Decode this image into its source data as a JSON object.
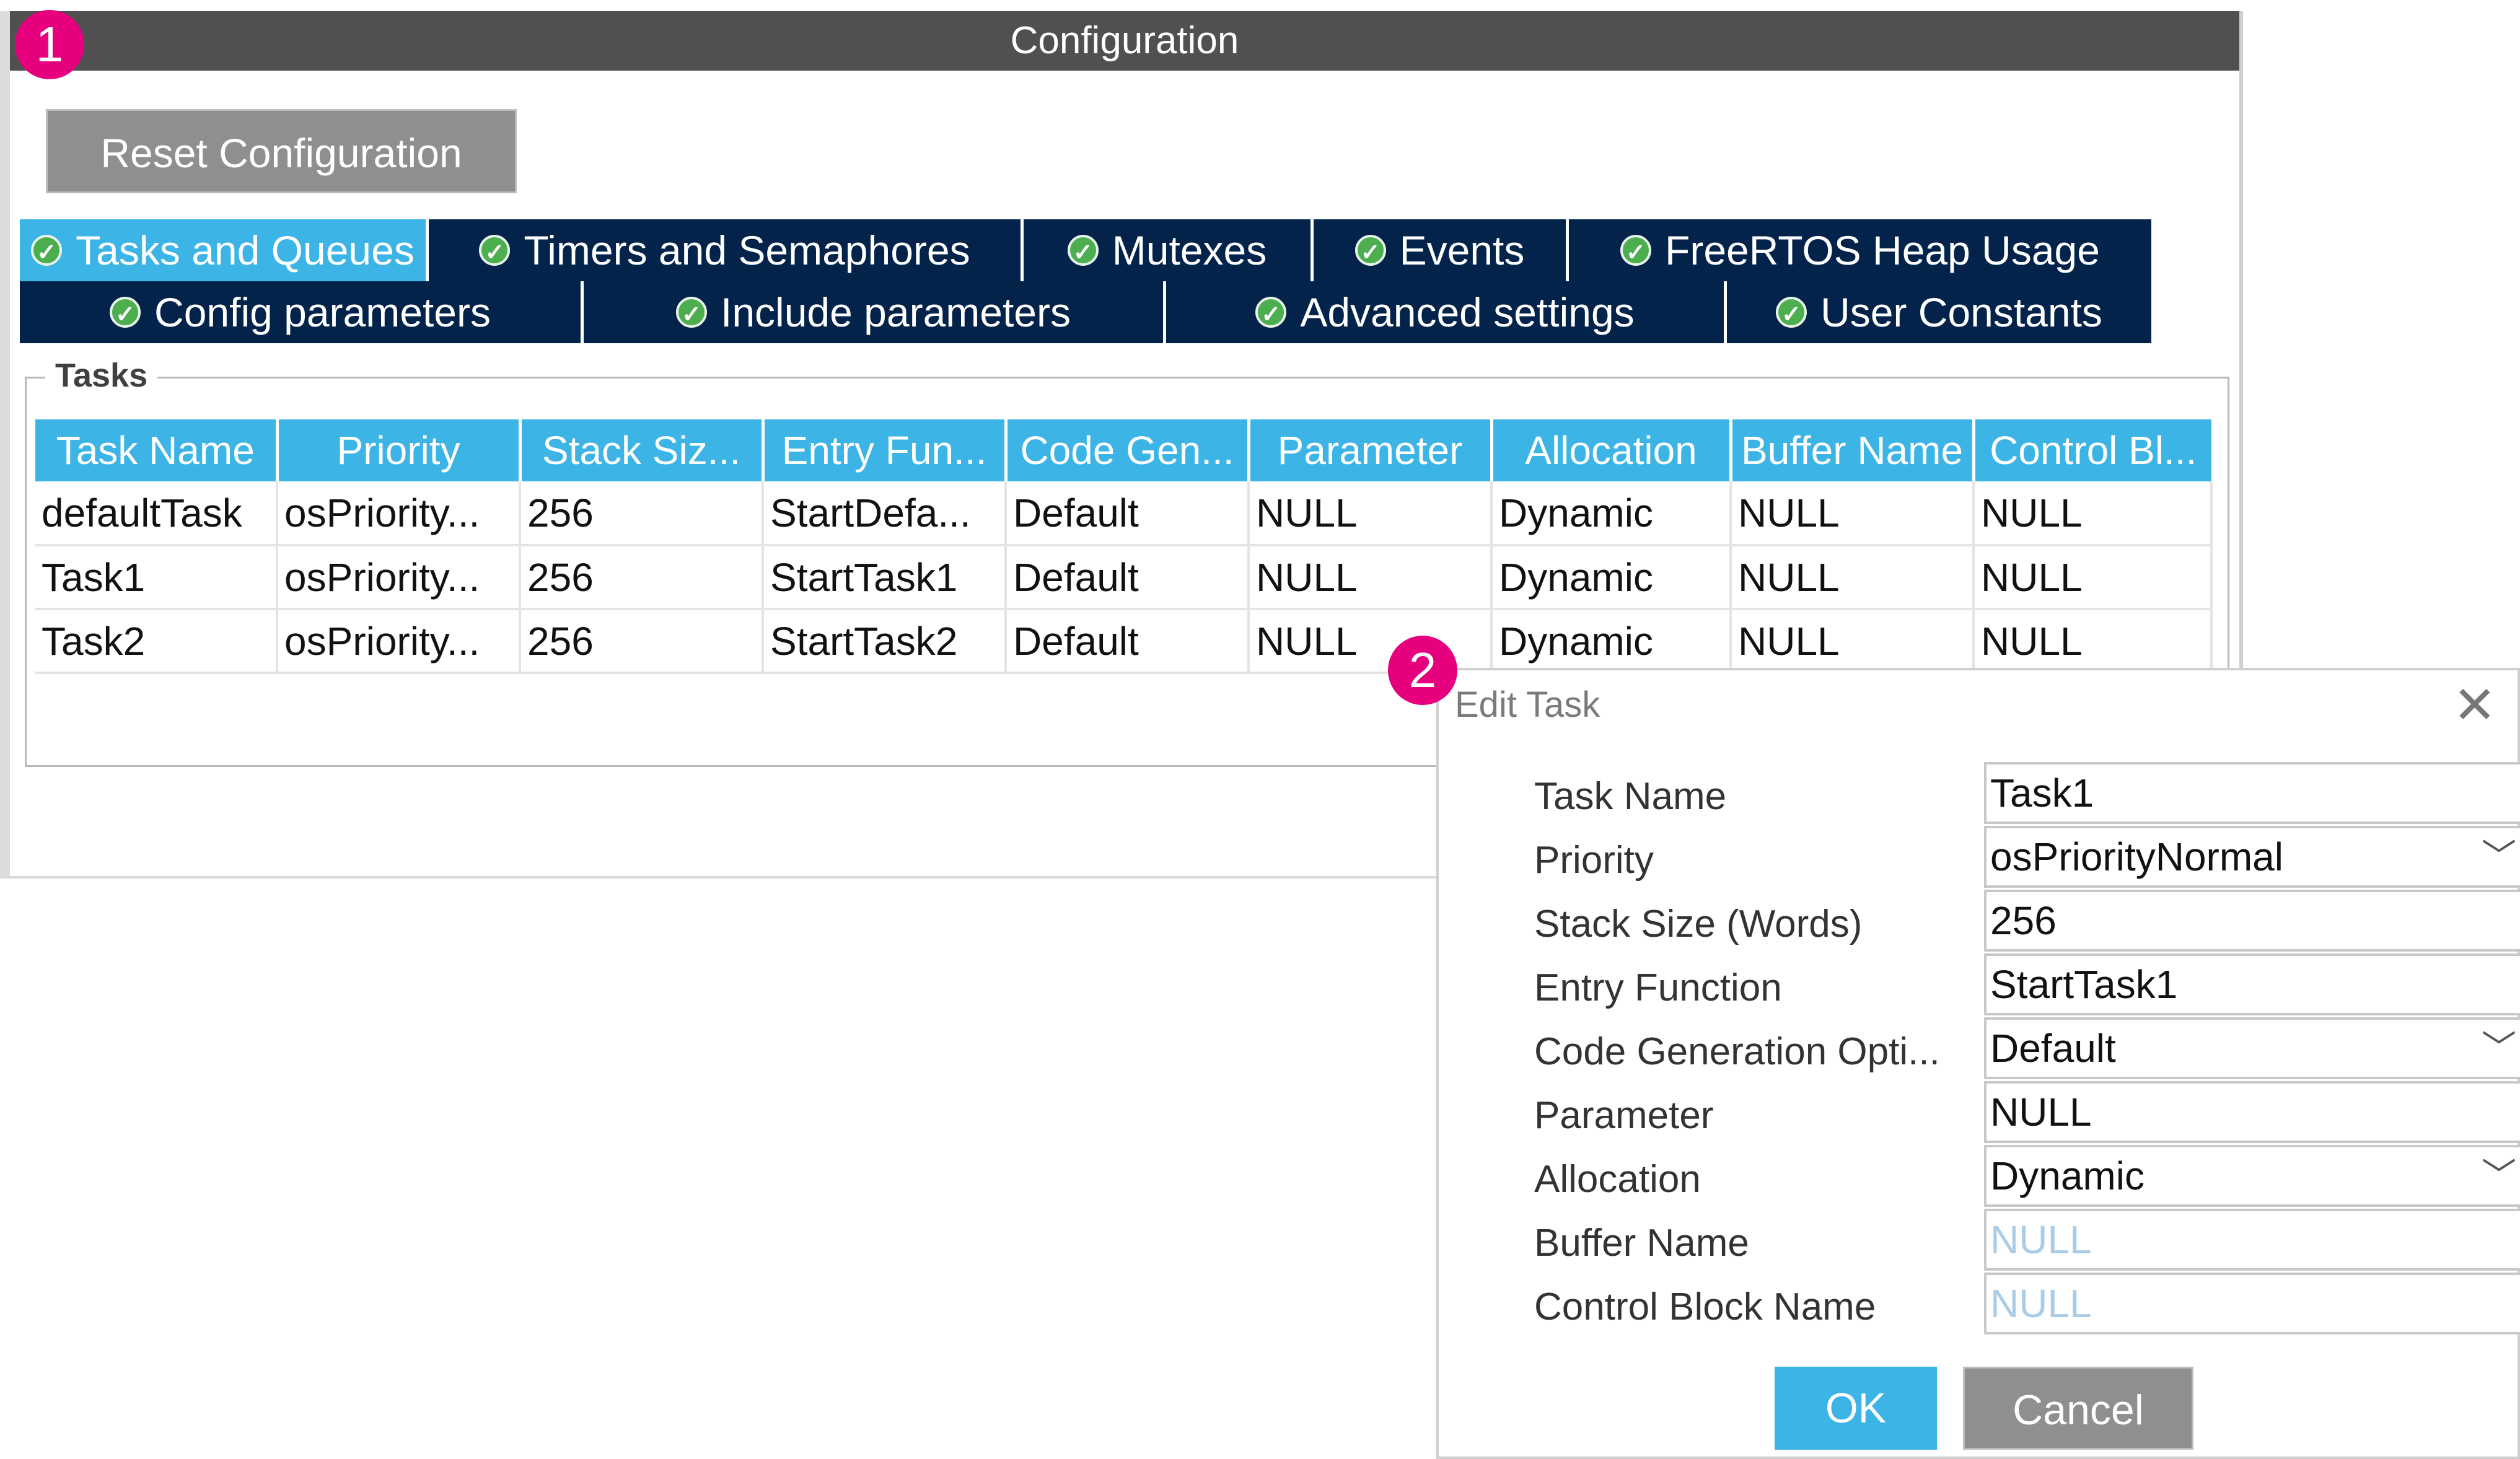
{
  "config": {
    "title": "Configuration",
    "reset_label": "Reset Configuration",
    "tabs_row1": [
      {
        "label": "Tasks and Queues",
        "active": true
      },
      {
        "label": "Timers and Semaphores",
        "active": false
      },
      {
        "label": "Mutexes",
        "active": false
      },
      {
        "label": "Events",
        "active": false
      },
      {
        "label": "FreeRTOS Heap Usage",
        "active": false
      }
    ],
    "tabs_row2": [
      {
        "label": "Config parameters"
      },
      {
        "label": "Include parameters"
      },
      {
        "label": "Advanced settings"
      },
      {
        "label": "User Constants"
      }
    ],
    "tasks_legend": "Tasks",
    "columns": [
      "Task Name",
      "Priority",
      "Stack Siz...",
      "Entry Fun...",
      "Code Gen...",
      "Parameter",
      "Allocation",
      "Buffer Name",
      "Control Bl..."
    ],
    "rows": [
      [
        "defaultTask",
        "osPriority...",
        "256",
        "StartDefa...",
        "Default",
        "NULL",
        "Dynamic",
        "NULL",
        "NULL"
      ],
      [
        "Task1",
        "osPriority...",
        "256",
        "StartTask1",
        "Default",
        "NULL",
        "Dynamic",
        "NULL",
        "NULL"
      ],
      [
        "Task2",
        "osPriority...",
        "256",
        "StartTask2",
        "Default",
        "NULL",
        "Dynamic",
        "NULL",
        "NULL"
      ]
    ]
  },
  "badges": {
    "one": "1",
    "two": "2"
  },
  "dialog": {
    "title": "Edit Task",
    "close_glyph": "✕",
    "fields": [
      {
        "label": "Task Name",
        "value": "Task1",
        "type": "text"
      },
      {
        "label": "Priority",
        "value": "osPriorityNormal",
        "type": "select"
      },
      {
        "label": "Stack Size (Words)",
        "value": "256",
        "type": "text"
      },
      {
        "label": "Entry Function",
        "value": "StartTask1",
        "type": "text"
      },
      {
        "label": "Code Generation Opti...",
        "value": "Default",
        "type": "select"
      },
      {
        "label": "Parameter",
        "value": "NULL",
        "type": "text"
      },
      {
        "label": "Allocation",
        "value": "Dynamic",
        "type": "select"
      },
      {
        "label": "Buffer Name",
        "value": "NULL",
        "type": "placeholder"
      },
      {
        "label": "Control Block Name",
        "value": "NULL",
        "type": "placeholder"
      }
    ],
    "ok_label": "OK",
    "cancel_label": "Cancel"
  },
  "colors": {
    "titlebar": "#505050",
    "tab_dark": "#03234b",
    "tab_active": "#3cb4e6",
    "badge": "#e6007e",
    "check": "#4cae4f"
  },
  "icons": {
    "tab_status": "check-circle-icon",
    "select": "chevron-down-icon",
    "close": "close-icon"
  }
}
